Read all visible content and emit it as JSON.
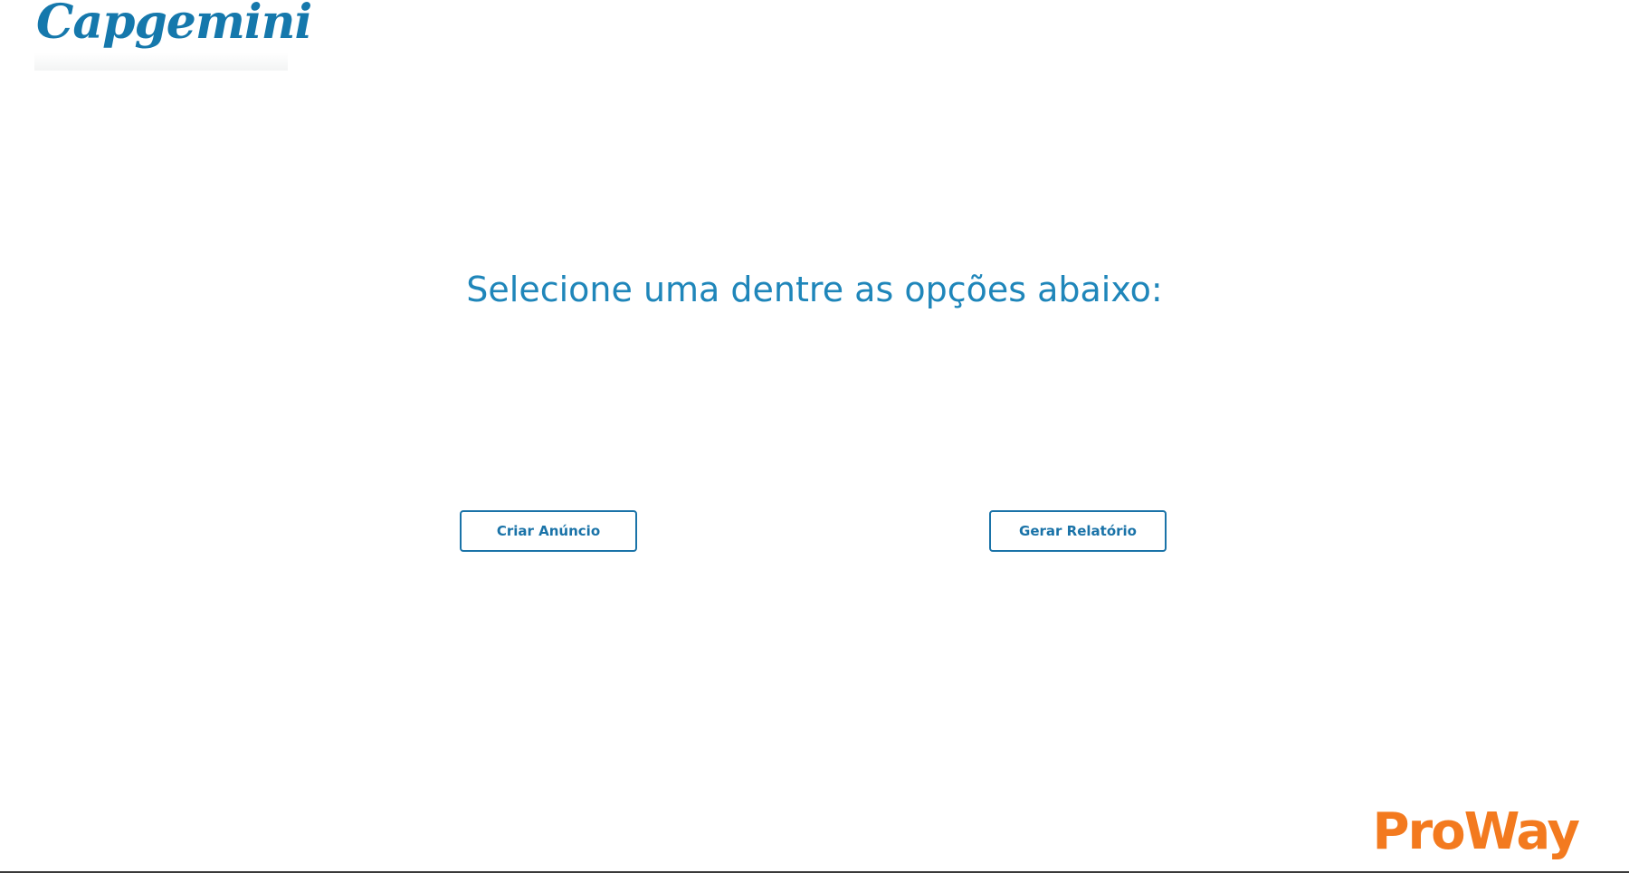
{
  "header": {
    "logo_text": "Capgemini"
  },
  "main": {
    "title": "Selecione uma dentre as opções abaixo:",
    "buttons": {
      "create_ad": "Criar Anúncio",
      "generate_report": "Gerar Relatório"
    }
  },
  "footer": {
    "logo_text": "ProWay"
  },
  "colors": {
    "primary_blue": "#1f86ba",
    "button_border": "#1a73a8",
    "proway_orange": "#f37a1f"
  }
}
